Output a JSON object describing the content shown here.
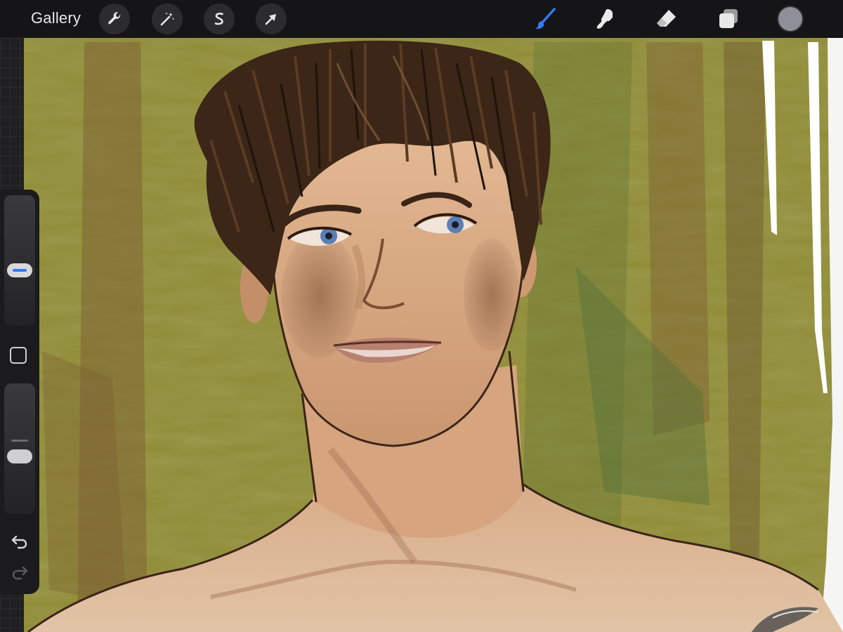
{
  "app": {
    "gallery_label": "Gallery"
  },
  "toolbar": {
    "left_tools": [
      {
        "name": "actions",
        "icon": "wrench-icon"
      },
      {
        "name": "adjustments",
        "icon": "magic-wand-icon"
      },
      {
        "name": "selection",
        "icon": "selection-s-icon"
      },
      {
        "name": "transform",
        "icon": "arrow-cursor-icon"
      }
    ],
    "right_tools": [
      {
        "name": "brush",
        "icon": "brush-icon",
        "active": true
      },
      {
        "name": "smudge",
        "icon": "smudge-finger-icon",
        "active": false
      },
      {
        "name": "eraser",
        "icon": "eraser-icon",
        "active": false
      },
      {
        "name": "layers",
        "icon": "layers-icon",
        "active": false
      }
    ],
    "current_color": "#8d9096"
  },
  "sidebar": {
    "brush_size_level": 0.41,
    "opacity_level": 0.57,
    "modify_button_icon": "square-icon",
    "undo_icon": "undo-arrow-icon",
    "redo_icon": "redo-arrow-icon"
  },
  "colors": {
    "accent_blue": "#2f7cf6",
    "toolbar_bg": "#151517",
    "canvas_bg_olive": "#8a8530"
  }
}
